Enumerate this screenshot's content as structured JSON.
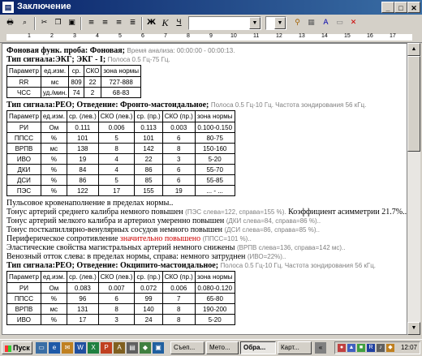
{
  "window": {
    "title": "Заключение"
  },
  "toolbar": {
    "font_value": "",
    "size_value": "",
    "bold": "Ж",
    "italic": "К",
    "underline": "Ч"
  },
  "ruler": {
    "labels": [
      "1",
      "2",
      "3",
      "4",
      "5",
      "6",
      "7",
      "8",
      "9",
      "10",
      "11",
      "12",
      "13",
      "14",
      "15",
      "16",
      "17"
    ]
  },
  "doc": {
    "bg_label": "Фоновая функ. проба: Фоновая;",
    "bg_meta": "Время анализа: 00:00:00 - 00:00:13.",
    "ecg_label": "Тип сигнала:ЭКГ; ЭКГ - I;",
    "ecg_meta": "Полоса 0.5 Гц-75 Гц.",
    "ecg_table": {
      "headers": [
        "Параметр",
        "ед.изм.",
        "ср.",
        "СКО",
        "зона нормы"
      ],
      "rows": [
        [
          "RR",
          "мс",
          "809",
          "22",
          "727-888"
        ],
        [
          "ЧСС",
          "уд./мин.",
          "74",
          "2",
          "68-83"
        ]
      ]
    },
    "reo1_label": "Тип сигнала:РЕО; Отведение: Фронто-мастоидальное;",
    "reo1_meta": "Полоса 0.5 Гц-10 Гц. Частота зондирования 56 кГц.",
    "reo_headers": [
      "Параметр",
      "ед.изм.",
      "ср. (лев.)",
      "СКО (лев.)",
      "ср. (пр.)",
      "СКО (пр.)",
      "зона нормы"
    ],
    "reo1_rows": [
      [
        "РИ",
        "Ом",
        "0.111",
        "0.006",
        "0.113",
        "0.003",
        "0.100-0.150"
      ],
      [
        "ППСС",
        "%",
        "101",
        "5",
        "101",
        "6",
        "80-75"
      ],
      [
        "ВРПВ",
        "мс",
        "138",
        "8",
        "142",
        "8",
        "150-160"
      ],
      [
        "ИВО",
        "%",
        "19",
        "4",
        "22",
        "3",
        "5-20"
      ],
      [
        "ДКИ",
        "%",
        "84",
        "4",
        "86",
        "6",
        "55-70"
      ],
      [
        "ДСИ",
        "%",
        "86",
        "5",
        "85",
        "6",
        "55-85"
      ],
      [
        "ПЭС",
        "%",
        "122",
        "17",
        "155",
        "19",
        "... - ..."
      ]
    ],
    "t1": "Пульсовое кровенаполнение в пределах нормы..",
    "t2": "Тонус артерий среднего калибра немного повышен",
    "t2_meta": "(ПЭС слева=122, справа=155 %).",
    "t2_extra": "Коэффициент асимметрии 21.7%..",
    "t3": "Тонус артерий мелкого калибра и артериол умеренно повышен",
    "t3_meta": "(ДКИ слева=84, справа=86 %)..",
    "t4": "Тонус посткапиллярно-венулярных сосудов немного повышен",
    "t4_meta": "(ДСИ слева=86, справа=85 %)..",
    "t5": "Периферическое сопротивление",
    "t5_red": "значительно повышено",
    "t5_meta": "(ППСС=101 %)..",
    "t6": "Эластические свойства магистральных артерий немного снижены",
    "t6_meta": "(ВРПВ слева=136, справа=142 мс)..",
    "t7": "Венозный отток слева: в пределах нормы, справа: немного затруднен",
    "t7_meta": "(ИВО=22%)..",
    "reo2_label": "Тип сигнала:РЕО; Отведение: Окципито-мастоидальное;",
    "reo2_meta": "Полоса 0.5 Гц-10 Гц. Частота зондирования 56 кГц.",
    "reo2_rows": [
      [
        "РИ",
        "Ом",
        "0.083",
        "0.007",
        "0.072",
        "0.006",
        "0.080-0.120"
      ],
      [
        "ППСС",
        "%",
        "96",
        "6",
        "99",
        "7",
        "65-80"
      ],
      [
        "ВРПВ",
        "мс",
        "131",
        "8",
        "140",
        "8",
        "190-200"
      ],
      [
        "ИВО",
        "%",
        "17",
        "3",
        "24",
        "8",
        "5-20"
      ]
    ]
  },
  "taskbar": {
    "start": "Пуск",
    "tasks": [
      "Съеп...",
      "Мето...",
      "Обра...",
      "Карт..."
    ],
    "clock": "12:07"
  }
}
